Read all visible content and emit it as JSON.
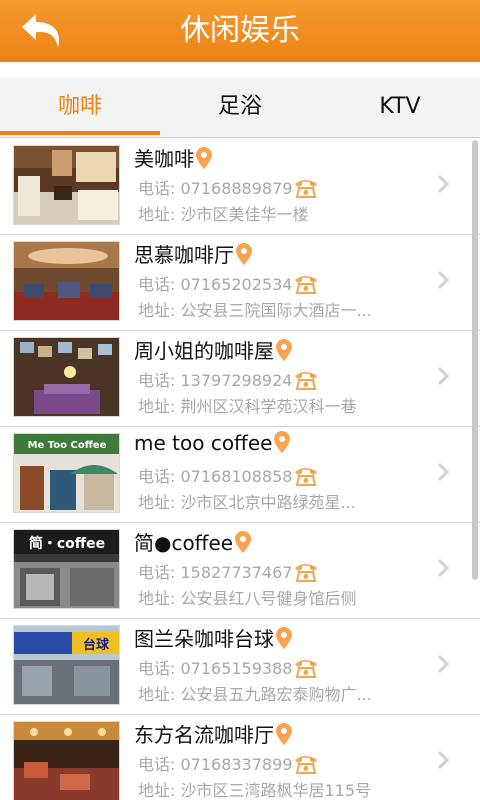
{
  "header": {
    "title": "休闲娱乐",
    "color": "#ee8217"
  },
  "tabs": [
    {
      "label": "咖啡",
      "active": true
    },
    {
      "label": "足浴",
      "active": false
    },
    {
      "label": "KTV",
      "active": false
    }
  ],
  "items": [
    {
      "name": "美咖啡",
      "phone": "电话: 07168889879",
      "address": "地址: 沙市区美佳华一楼"
    },
    {
      "name": "思慕咖啡厅",
      "phone": "电话: 07165202534",
      "address": "地址: 公安县三院国际大酒店一..."
    },
    {
      "name": "周小姐的咖啡屋",
      "phone": "电话: 13797298924",
      "address": "地址: 荆州区汉科学苑汉科一巷"
    },
    {
      "name": "me too coffee",
      "phone": "电话: 07168108858",
      "address": "地址: 沙市区北京中路绿苑星...",
      "sign": "Me Too Coffee"
    },
    {
      "name": "简●coffee",
      "phone": "电话: 15827737467",
      "address": "地址: 公安县红八号健身馆后侧",
      "sign": "简・coffee"
    },
    {
      "name": "图兰朵咖啡台球",
      "phone": "电话: 07165159388",
      "address": "地址: 公安县五九路宏泰购物广...",
      "sign": "台球"
    },
    {
      "name": "东方名流咖啡厅",
      "phone": "电话: 07168337899",
      "address": "地址: 沙市区三湾路枫华居115号"
    }
  ]
}
